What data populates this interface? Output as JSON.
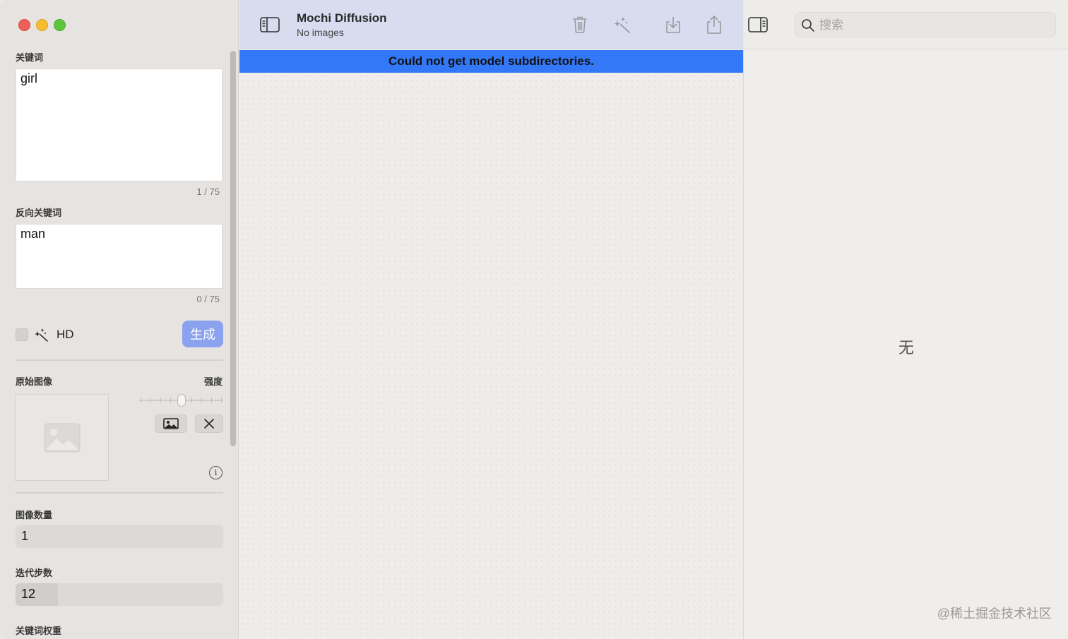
{
  "window": {
    "title": "Mochi Diffusion",
    "subtitle": "No images"
  },
  "sidebar": {
    "prompt_label": "关键词",
    "prompt_value": "girl",
    "prompt_counter": "1 / 75",
    "negative_label": "反向关键词",
    "negative_value": "man",
    "negative_counter": "0 / 75",
    "hd_label": "HD",
    "hd_checked": false,
    "generate_label": "生成",
    "source_image_label": "原始图像",
    "strength_label": "强度",
    "strength_level": 0.5,
    "image_count_label": "图像数量",
    "image_count_value": "1",
    "steps_label": "迭代步数",
    "steps_value": "12",
    "guidance_label": "关键词权重"
  },
  "toolbar": {
    "icons": [
      "sidebar-toggle-icon",
      "trash-icon",
      "magic-wand-icon",
      "download-icon",
      "share-icon",
      "inspector-toggle-icon"
    ],
    "search_placeholder": "搜索"
  },
  "banner": {
    "message": "Could not get model subdirectories.",
    "color": "#3378f6"
  },
  "inspector": {
    "empty_text": "无"
  },
  "watermark": "@稀土掘金技术社区",
  "colors": {
    "accent": "#8ba3ee",
    "toolbar_tint": "#d7ddef"
  }
}
